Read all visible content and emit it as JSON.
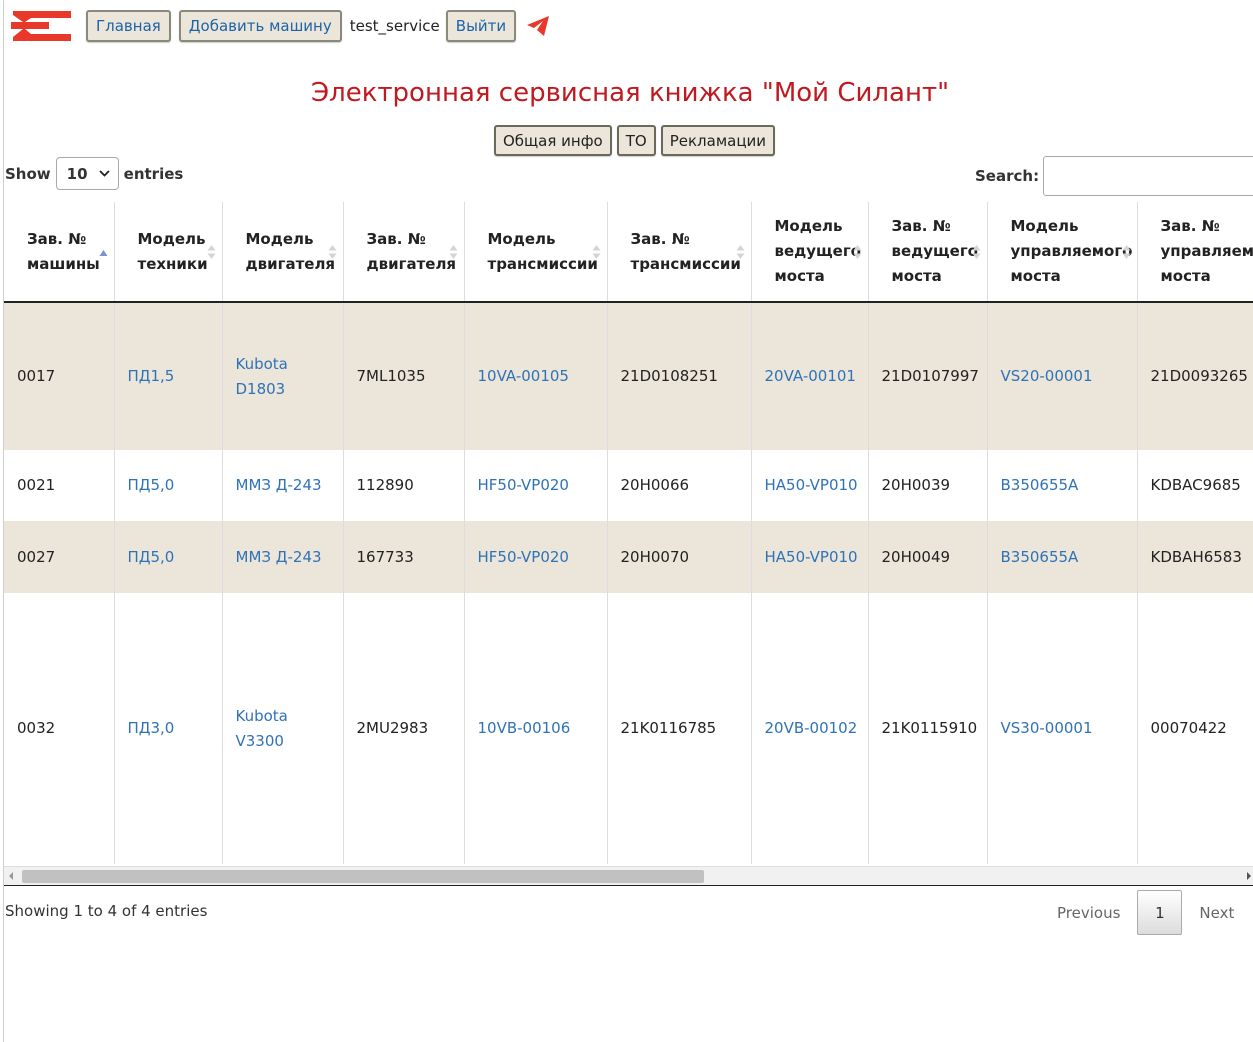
{
  "nav": {
    "home": "Главная",
    "add_machine": "Добавить машину",
    "username": "test_service",
    "logout": "Выйти"
  },
  "page_title": "Электронная сервисная книжка \"Мой Силант\"",
  "tabs": [
    "Общая инфо",
    "ТО",
    "Рекламации"
  ],
  "length_control": {
    "show": "Show",
    "value": "10",
    "entries": "entries"
  },
  "search": {
    "label": "Search:"
  },
  "table": {
    "columns": [
      "Зав. № машины",
      "Модель техники",
      "Модель двигателя",
      "Зав. № двигателя",
      "Модель трансмиссии",
      "Зав. № трансмиссии",
      "Модель ведущего моста",
      "Зав. № ведущего моста",
      "Модель управляемого моста",
      "Зав. № управляемого моста"
    ],
    "rows": [
      [
        "0017",
        "ПД1,5",
        "Kubota D1803",
        "7ML1035",
        "10VA-00105",
        "21D0108251",
        "20VA-00101",
        "21D0107997",
        "VS20-00001",
        "21D0093265"
      ],
      [
        "0021",
        "ПД5,0",
        "ММЗ Д-243",
        "112890",
        "HF50-VP020",
        "20H0066",
        "HA50-VP010",
        "20H0039",
        "B350655A",
        "KDBAC9685"
      ],
      [
        "0027",
        "ПД5,0",
        "ММЗ Д-243",
        "167733",
        "HF50-VP020",
        "20H0070",
        "HA50-VP010",
        "20H0049",
        "B350655A",
        "KDBAH6583"
      ],
      [
        "0032",
        "ПД3,0",
        "Kubota V3300",
        "2MU2983",
        "10VB-00106",
        "21K0116785",
        "20VB-00102",
        "21K0115910",
        "VS30-00001",
        "00070422"
      ]
    ]
  },
  "footer": {
    "info": "Showing 1 to 4 of 4 entries",
    "previous": "Previous",
    "page": "1",
    "next": "Next"
  },
  "colors": {
    "brand_red": "#c0191f",
    "link_blue": "#2f72b6",
    "row_stripe": "#ece6da"
  }
}
